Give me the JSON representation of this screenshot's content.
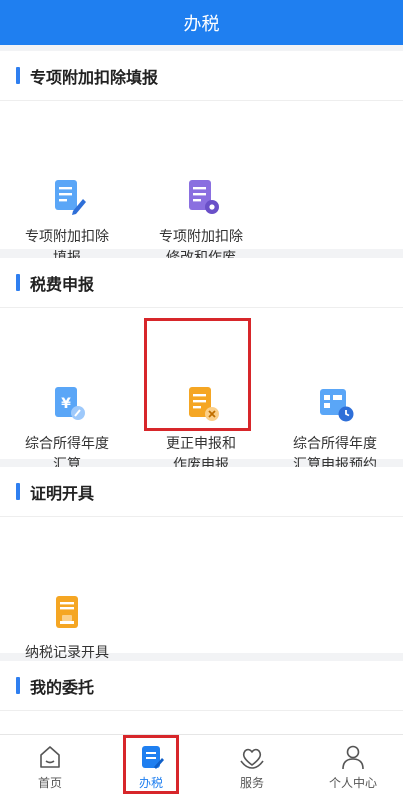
{
  "header": {
    "title": "办税"
  },
  "sections": [
    {
      "title": "专项附加扣除填报",
      "items": [
        {
          "label_line1": "专项附加扣除",
          "label_line2": "填报",
          "icon": "document-edit-icon"
        },
        {
          "label_line1": "专项附加扣除",
          "label_line2": "修改和作废",
          "icon": "document-settings-icon"
        }
      ]
    },
    {
      "title": "税费申报",
      "items": [
        {
          "label_line1": "综合所得年度",
          "label_line2": "汇算",
          "icon": "yuan-receipt-icon"
        },
        {
          "label_line1": "更正申报和",
          "label_line2": "作废申报",
          "icon": "document-cancel-icon"
        },
        {
          "label_line1": "综合所得年度",
          "label_line2": "汇算申报预约",
          "icon": "calendar-clock-icon"
        }
      ]
    },
    {
      "title": "证明开具",
      "items": [
        {
          "label_line1": "纳税记录开具",
          "label_line2": "",
          "icon": "certificate-icon"
        }
      ]
    },
    {
      "title": "我的委托",
      "items": []
    }
  ],
  "tabbar": [
    {
      "label": "首页",
      "icon": "home-icon"
    },
    {
      "label": "办税",
      "icon": "tax-document-icon",
      "active": true
    },
    {
      "label": "服务",
      "icon": "heart-hands-icon"
    },
    {
      "label": "个人中心",
      "icon": "person-icon"
    }
  ],
  "colors": {
    "brand": "#1f7ff0",
    "highlight": "#d7262a",
    "orange": "#f5a623",
    "purple": "#8a6fe0"
  }
}
